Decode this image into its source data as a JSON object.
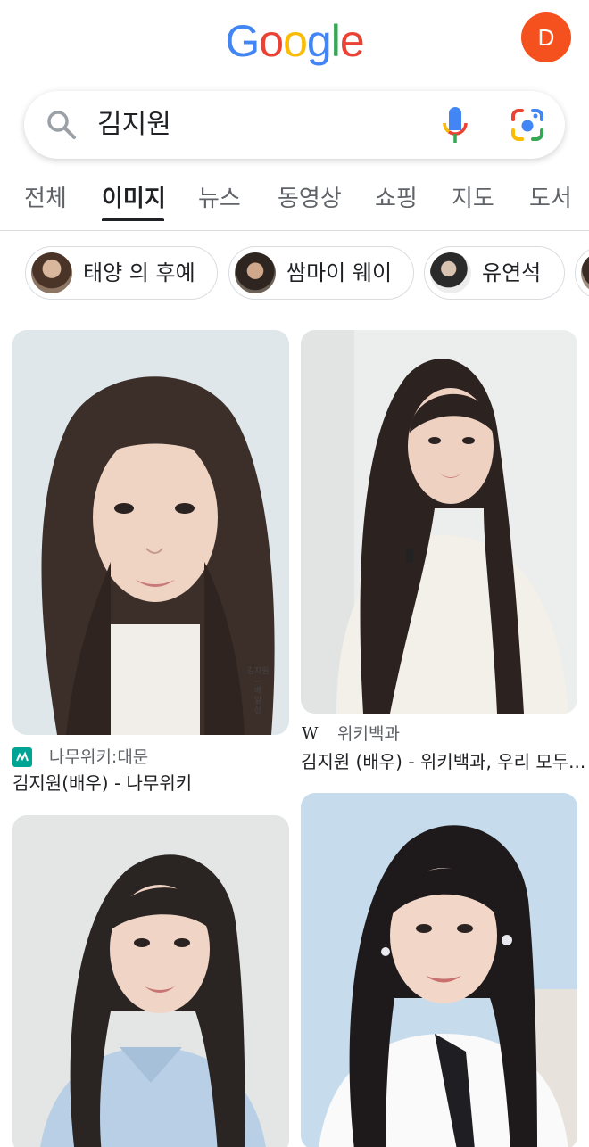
{
  "header": {
    "logo_letters": [
      "G",
      "o",
      "o",
      "g",
      "l",
      "e"
    ],
    "logo_colors": [
      "#4285F4",
      "#EA4335",
      "#FBBC05",
      "#4285F4",
      "#34A853",
      "#EA4335"
    ],
    "avatar_initial": "D",
    "avatar_color": "#F4511E"
  },
  "search": {
    "query": "김지원",
    "icons": [
      "search-icon",
      "mic-icon",
      "google-lens-icon"
    ]
  },
  "tabs": [
    {
      "label": "전체",
      "active": false
    },
    {
      "label": "이미지",
      "active": true
    },
    {
      "label": "뉴스",
      "active": false
    },
    {
      "label": "동영상",
      "active": false
    },
    {
      "label": "쇼핑",
      "active": false
    },
    {
      "label": "지도",
      "active": false
    },
    {
      "label": "도서",
      "active": false
    }
  ],
  "chips": [
    {
      "label": "태양 의 후예"
    },
    {
      "label": "쌈마이 웨이"
    },
    {
      "label": "유연석"
    }
  ],
  "results": [
    {
      "source": "나무위키:대문",
      "source_icon": "namuwiki-icon",
      "title": "김지원(배우) - 나무위키",
      "caption_lines": [
        "김지원",
        "—",
        "배",
        "일",
        "상"
      ]
    },
    {
      "source": "위키백과",
      "source_icon": "wikipedia-icon",
      "title": "김지원 (배우) - 위키백과, 우리 모두..."
    },
    {
      "source": "",
      "title": ""
    },
    {
      "source": "",
      "title": ""
    }
  ]
}
